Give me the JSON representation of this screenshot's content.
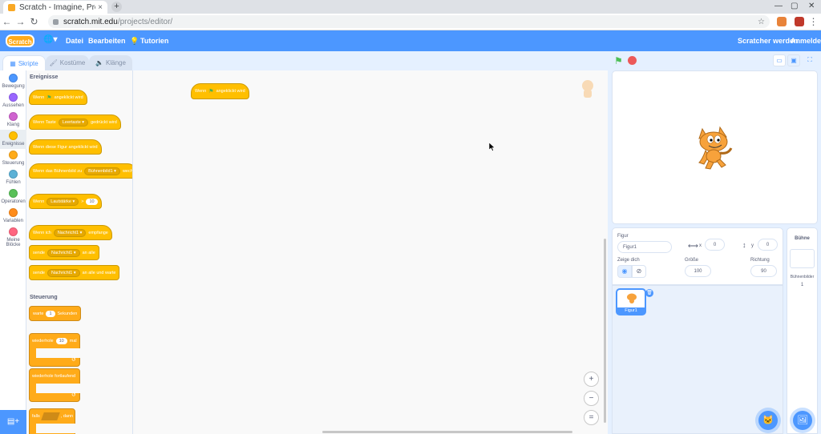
{
  "browser": {
    "tab_title": "Scratch - Imagine, Prog",
    "tab_close": "×",
    "new_tab": "+",
    "window_min": "—",
    "window_max": "▢",
    "window_close": "✕",
    "url_host": "scratch.mit.edu",
    "url_path": "/projects/editor/",
    "star": "☆",
    "menu": "⋮"
  },
  "menubar": {
    "logo": "Scratch",
    "language_icon": "🌐▾",
    "file": "Datei",
    "edit": "Bearbeiten",
    "tutorials": "Tutorien",
    "join": "Scratcher werden",
    "signin": "Anmelden"
  },
  "editor_tabs": [
    {
      "label": "Skripte"
    },
    {
      "label": "Kostüme"
    },
    {
      "label": "Klänge"
    }
  ],
  "categories": [
    {
      "label": "Bewegung",
      "color": "#4c97ff"
    },
    {
      "label": "Aussehen",
      "color": "#9966ff"
    },
    {
      "label": "Klang",
      "color": "#cf63cf"
    },
    {
      "label": "Ereignisse",
      "color": "#ffbf00"
    },
    {
      "label": "Steuerung",
      "color": "#ffab19"
    },
    {
      "label": "Fühlen",
      "color": "#5cb1d6"
    },
    {
      "label": "Operatoren",
      "color": "#59c059"
    },
    {
      "label": "Variablen",
      "color": "#ff8c1a"
    },
    {
      "label": "Meine Blöcke",
      "color": "#ff6680"
    }
  ],
  "palette": {
    "events_heading": "Ereignisse",
    "b1": "Wenn",
    "b1b": "angeklickt wird",
    "b2a": "Wenn Taste",
    "b2dd": "Leertaste ▾",
    "b2b": "gedrückt wird",
    "b3": "Wenn diese Figur angeklickt wird",
    "b4a": "Wenn das Bühnenbild zu",
    "b4dd": "Bühnenbild1 ▾",
    "b4b": "wech",
    "b5a": "Wenn",
    "b5dd": "Lautstärke ▾",
    "b5op": ">",
    "b5v": "10",
    "b6a": "Wenn ich",
    "b6dd": "Nachricht1 ▾",
    "b6b": "empfange",
    "b7a": "sende",
    "b7dd": "Nachricht1 ▾",
    "b7b": "an alle",
    "b8a": "sende",
    "b8dd": "Nachricht1 ▾",
    "b8b": "an alle und warte",
    "control_heading": "Steuerung",
    "c1a": "warte",
    "c1v": "1",
    "c1b": "Sekunden",
    "c2a": "wiederhole",
    "c2v": "10",
    "c2b": "mal",
    "c3": "wiederhole fortlaufend",
    "c4a": "falls",
    "c4b": ", dann",
    "loop_arrow": "↺"
  },
  "workspace": {
    "block_a": "Wenn",
    "block_b": "angeklickt wird",
    "zoom_in": "+",
    "zoom_out": "−",
    "zoom_reset": "="
  },
  "stage_controls": {
    "flag": "⚑",
    "small": "▭",
    "normal": "▣",
    "full": "⛶"
  },
  "sprite_info": {
    "sprite_label": "Figur",
    "sprite_name": "Figur1",
    "x_label": "x",
    "x_value": "0",
    "y_label": "y",
    "y_value": "0",
    "x_arrow": "⟷",
    "y_arrow": "↕",
    "show_label": "Zeige dich",
    "size_label": "Größe",
    "size_value": "100",
    "direction_label": "Richtung",
    "direction_value": "90",
    "eye_on": "◉",
    "eye_off": "⊘"
  },
  "sprite_list": {
    "thumb_name": "Figur1",
    "delete": "🗑",
    "add_sprite": "🐱"
  },
  "backdrop": {
    "title": "Bühne",
    "label": "Bühnenbilder",
    "count": "1",
    "add": "🖼"
  }
}
